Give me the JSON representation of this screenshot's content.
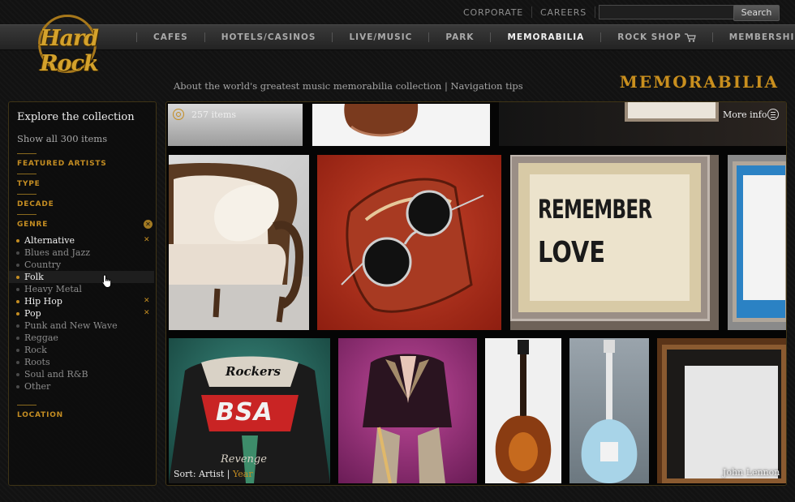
{
  "top_links": [
    "CORPORATE",
    "CAREERS"
  ],
  "search": {
    "button_label": "Search",
    "value": ""
  },
  "logo_text": "Hard Rock",
  "nav": [
    "CAFES",
    "HOTELS/CASINOS",
    "LIVE/MUSIC",
    "PARK",
    "MEMORABILIA",
    "ROCK SHOP",
    "MEMBERSHIPS"
  ],
  "nav_active": "MEMORABILIA",
  "subheader": {
    "about": "About the world's greatest music memorabilia collection",
    "separator": " | ",
    "tips": "Navigation tips",
    "page_title": "MEMORABILIA"
  },
  "sidebar": {
    "title": "Explore the collection",
    "show_all": "Show all 300 items",
    "sections": {
      "featured": "FEATURED ARTISTS",
      "type": "TYPE",
      "decade": "DECADE",
      "genre": "GENRE",
      "location": "LOCATION"
    },
    "genres": [
      {
        "label": "Alternative",
        "selected": true
      },
      {
        "label": "Blues and Jazz",
        "selected": false
      },
      {
        "label": "Country",
        "selected": false
      },
      {
        "label": "Folk",
        "selected": true,
        "hover": true
      },
      {
        "label": "Heavy Metal",
        "selected": false
      },
      {
        "label": "Hip Hop",
        "selected": true
      },
      {
        "label": "Pop",
        "selected": true
      },
      {
        "label": "Punk and New Wave",
        "selected": false
      },
      {
        "label": "Reggae",
        "selected": false
      },
      {
        "label": "Rock",
        "selected": false
      },
      {
        "label": "Roots",
        "selected": false
      },
      {
        "label": "Soul and R&B",
        "selected": false
      },
      {
        "label": "Other",
        "selected": false
      }
    ]
  },
  "gallery": {
    "count": "257 items",
    "more_info": "More info",
    "sort_label": "Sort:",
    "sort_artist": "Artist",
    "sort_sep": " | ",
    "sort_year": "Year",
    "caption": "John Lennon",
    "artwork_text": [
      "REMEMBER",
      "LOVE"
    ],
    "jacket_text": [
      "Rockers",
      "BSA",
      "Revenge"
    ]
  },
  "colors": {
    "accent": "#c48d22",
    "background": "#121212"
  }
}
